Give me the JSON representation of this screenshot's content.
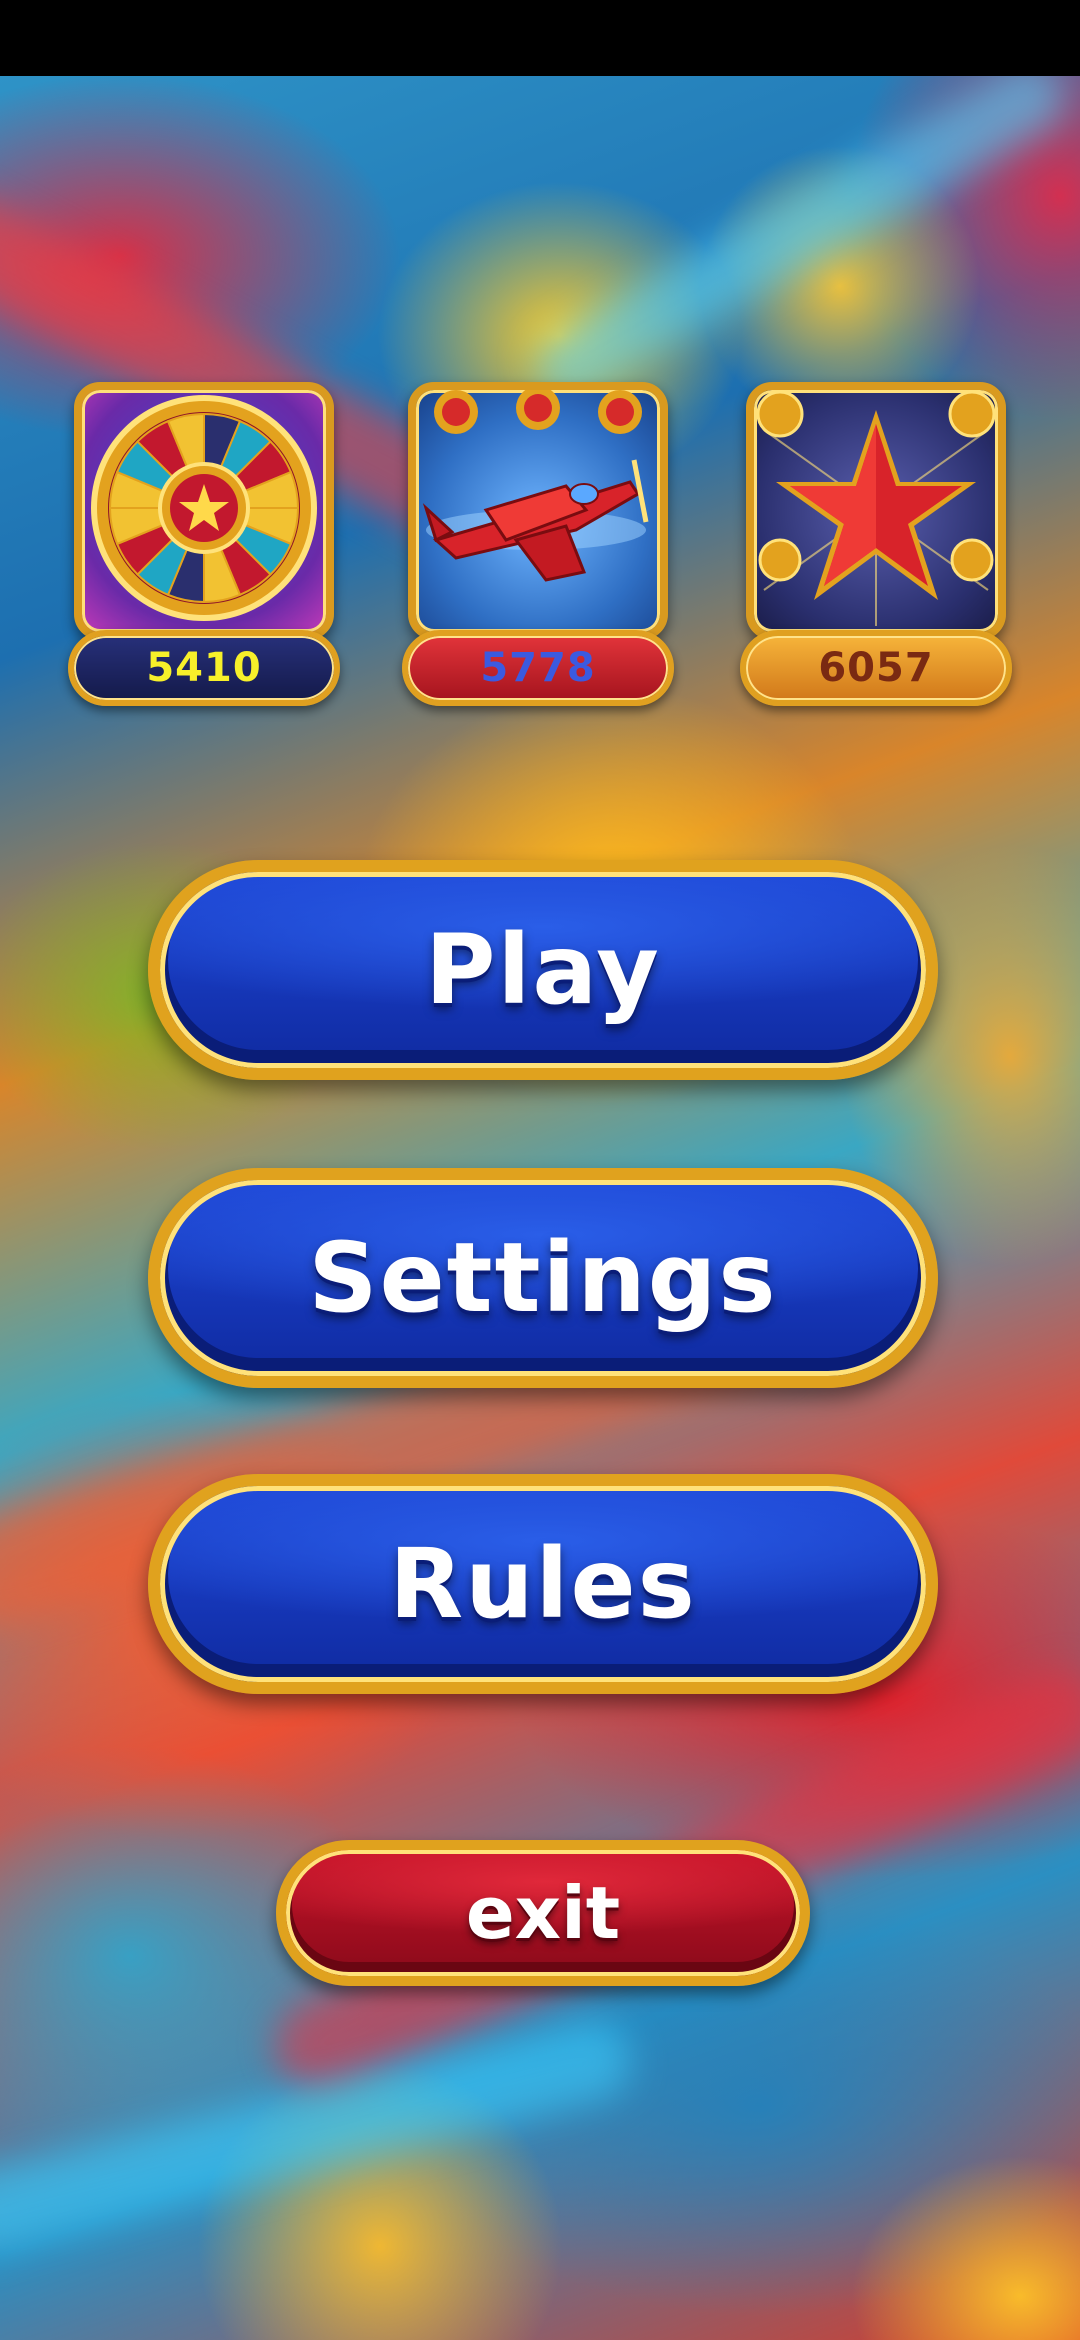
{
  "tiles": [
    {
      "name": "roulette",
      "counter": "5410",
      "icon": "roulette-wheel-icon"
    },
    {
      "name": "airplane",
      "counter": "5778",
      "icon": "airplane-icon"
    },
    {
      "name": "star",
      "counter": "6057",
      "icon": "star-icon"
    }
  ],
  "menu": {
    "play_label": "Play",
    "settings_label": "Settings",
    "rules_label": "Rules",
    "exit_label": "exit"
  },
  "colors": {
    "button_blue": "#1f48d8",
    "button_red": "#c8142a",
    "gold_border": "#e0a21e"
  }
}
